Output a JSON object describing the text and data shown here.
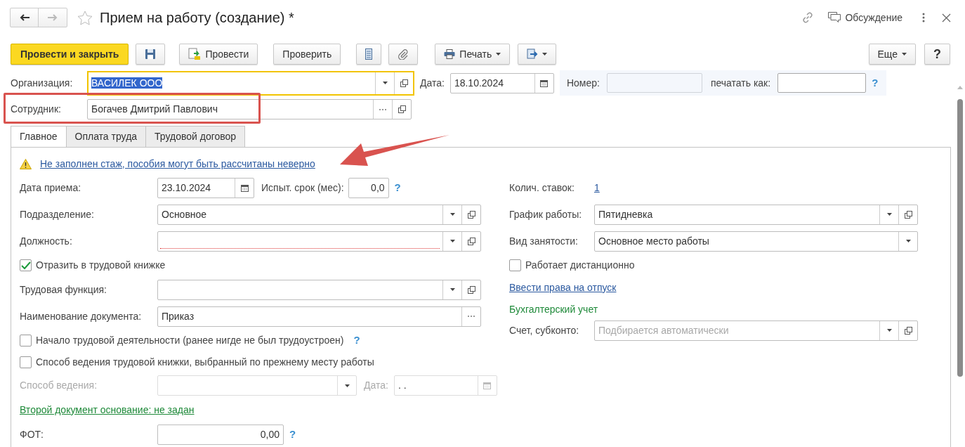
{
  "window": {
    "title": "Прием на работу (создание) *",
    "discussion": "Обсуждение"
  },
  "toolbar": {
    "post_close": "Провести и закрыть",
    "post": "Провести",
    "check": "Проверить",
    "print": "Печать",
    "more": "Еще",
    "help": "?"
  },
  "header": {
    "organization": {
      "label": "Организация:",
      "value": "ВАСИЛЕК ООО",
      "focused": true,
      "text_selected": true
    },
    "date": {
      "label": "Дата:",
      "value": "18.10.2024"
    },
    "number": {
      "label": "Номер:",
      "disabled": true
    },
    "print_as": {
      "label": "печатать как:",
      "help": "?"
    },
    "employee": {
      "label": "Сотрудник:",
      "value": "Богачев Дмитрий Павлович"
    }
  },
  "tabs": [
    {
      "label": "Главное",
      "selected": true
    },
    {
      "label": "Оплата труда",
      "selected": false
    },
    {
      "label": "Трудовой договор",
      "selected": false
    }
  ],
  "warning": "Не заполнен стаж, пособия могут быть рассчитаны неверно",
  "left": [
    {
      "kind": "date_trial",
      "label": "Дата приема:",
      "value": "23.10.2024",
      "trial_label": "Испыт. срок (мес):",
      "trial_value": "0,0",
      "help": "?"
    },
    {
      "kind": "select",
      "label": "Подразделение:",
      "value": "Основное",
      "dropdown": true,
      "open": true,
      "required": false
    },
    {
      "kind": "select",
      "label": "Должность:",
      "dropdown": true,
      "open": true,
      "required": true
    },
    {
      "kind": "checkbox",
      "label": "Отразить в трудовой книжке",
      "checked": true
    },
    {
      "kind": "select",
      "label": "Трудовая функция:",
      "dropdown": true,
      "open": true,
      "required": false
    },
    {
      "kind": "choice",
      "label": "Наименование документа:",
      "value": "Приказ"
    },
    {
      "kind": "checkbox",
      "label": "Начало трудовой деятельности (ранее нигде не был трудоустроен)",
      "checked": false,
      "help": "?"
    },
    {
      "kind": "checkbox",
      "label": "Способ ведения трудовой книжки, выбранный по прежнему месту работы",
      "checked": false
    },
    {
      "kind": "disabled_pair",
      "label": "Способ ведения:",
      "date_label": "Дата:",
      "date_value": ". ."
    },
    {
      "kind": "basis_link",
      "label": "Второй документ основание: не задан"
    },
    {
      "kind": "number",
      "label": "ФОТ:",
      "value": "0,00",
      "help": "?"
    }
  ],
  "right": [
    {
      "kind": "link_value",
      "label": "Колич. ставок:",
      "value": "1"
    },
    {
      "kind": "select",
      "label": "График работы:",
      "value": "Пятидневка",
      "dropdown": true,
      "open": true,
      "required": false
    },
    {
      "kind": "select",
      "label": "Вид занятости:",
      "value": "Основное место работы",
      "dropdown": true,
      "open": false,
      "required": false
    },
    {
      "kind": "checkbox",
      "label": "Работает дистанционно",
      "checked": false
    },
    {
      "kind": "link",
      "label": "Ввести права на отпуск"
    },
    {
      "kind": "heading",
      "label": "Бухгалтерский учет"
    },
    {
      "kind": "select",
      "label": "Счет, субконто:",
      "placeholder": "Подбирается автоматически",
      "dropdown": true,
      "open": true,
      "required": false
    }
  ]
}
